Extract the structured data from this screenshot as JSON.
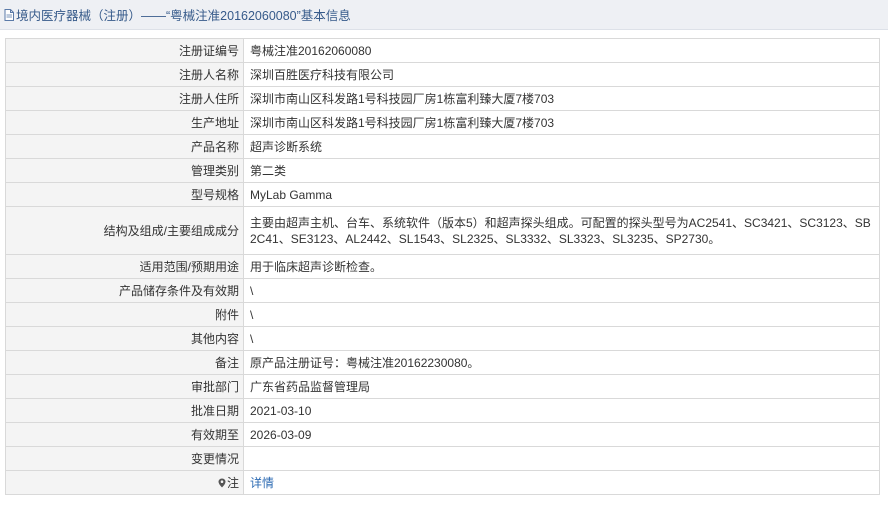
{
  "header": {
    "title": "境内医疗器械（注册）——“粤械注准20162060080”基本信息"
  },
  "colors": {
    "header_bg": "#eef0f4",
    "label_bg": "#f4f4f4",
    "border": "#d9d9d9",
    "link": "#2d6bb3",
    "title": "#365a8a"
  },
  "rows": [
    {
      "label": "注册证编号",
      "value": "粤械注准20162060080"
    },
    {
      "label": "注册人名称",
      "value": "深圳百胜医疗科技有限公司"
    },
    {
      "label": "注册人住所",
      "value": "深圳市南山区科发路1号科技园厂房1栋富利臻大厦7楼703"
    },
    {
      "label": "生产地址",
      "value": "深圳市南山区科发路1号科技园厂房1栋富利臻大厦7楼703"
    },
    {
      "label": "产品名称",
      "value": "超声诊断系统"
    },
    {
      "label": "管理类别",
      "value": "第二类"
    },
    {
      "label": "型号规格",
      "value": "MyLab Gamma"
    },
    {
      "label": "结构及组成/主要组成成分",
      "value": "主要由超声主机、台车、系统软件（版本5）和超声探头组成。可配置的探头型号为AC2541、SC3421、SC3123、SB2C41、SE3123、AL2442、SL1543、SL2325、SL3332、SL3323、SL3235、SP2730。"
    },
    {
      "label": "适用范围/预期用途",
      "value": "用于临床超声诊断检查。"
    },
    {
      "label": "产品储存条件及有效期",
      "value": "\\"
    },
    {
      "label": "附件",
      "value": "\\"
    },
    {
      "label": "其他内容",
      "value": "\\"
    },
    {
      "label": "备注",
      "value": "原产品注册证号：粤械注准20162230080。"
    },
    {
      "label": "审批部门",
      "value": "广东省药品监督管理局"
    },
    {
      "label": "批准日期",
      "value": "2021-03-10"
    },
    {
      "label": "有效期至",
      "value": "2026-03-09"
    },
    {
      "label": "变更情况",
      "value": ""
    },
    {
      "label": "注",
      "value": "详情"
    }
  ],
  "icons": {
    "header": "document-icon",
    "note": "pin-icon"
  }
}
